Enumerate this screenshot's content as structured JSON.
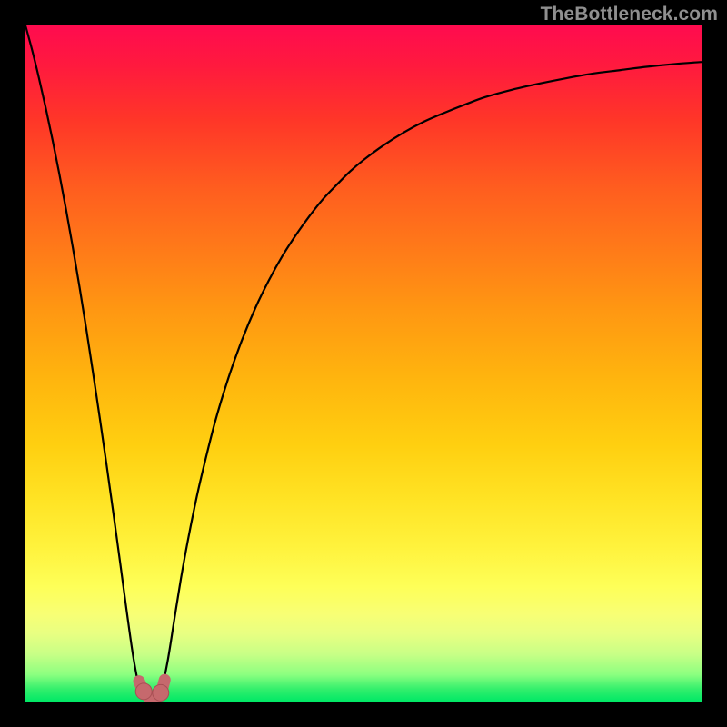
{
  "watermark": "TheBottleneck.com",
  "colors": {
    "frame": "#000000",
    "curve": "#000000",
    "marker_fill": "#c6696d",
    "marker_stroke": "#a84f54",
    "gradient_top": "#ff0b4f",
    "gradient_bottom": "#00e866"
  },
  "chart_data": {
    "type": "line",
    "title": "",
    "xlabel": "",
    "ylabel": "",
    "xlim": [
      0,
      100
    ],
    "ylim": [
      0,
      100
    ],
    "x": [
      0,
      1,
      2,
      3,
      4,
      5,
      6,
      7,
      8,
      9,
      10,
      11,
      12,
      13,
      14,
      15,
      16,
      17,
      18,
      19,
      20,
      21,
      22,
      23,
      24,
      25,
      26,
      28,
      30,
      32,
      34,
      36,
      38,
      40,
      42,
      44,
      46,
      48,
      50,
      53,
      56,
      59,
      62,
      65,
      68,
      72,
      76,
      80,
      84,
      88,
      92,
      96,
      100
    ],
    "y": [
      100,
      96.3,
      92.2,
      87.8,
      83.1,
      78.1,
      72.8,
      67.2,
      61.3,
      55.1,
      48.6,
      41.9,
      35.0,
      27.9,
      20.6,
      13.2,
      6.3,
      1.5,
      0.3,
      0.2,
      1.3,
      5.8,
      12.0,
      18.2,
      23.7,
      28.7,
      33.2,
      41.2,
      47.8,
      53.4,
      58.2,
      62.3,
      65.9,
      69.0,
      71.8,
      74.3,
      76.4,
      78.4,
      80.1,
      82.3,
      84.2,
      85.8,
      87.1,
      88.3,
      89.4,
      90.5,
      91.4,
      92.2,
      92.9,
      93.4,
      93.9,
      94.3,
      94.6
    ],
    "markers": [
      {
        "x": 17.5,
        "y": 1.5
      },
      {
        "x": 20.0,
        "y": 1.3
      }
    ],
    "band": {
      "x": [
        16.8,
        17.5,
        18.3,
        19.1,
        20.0,
        20.6
      ],
      "y": [
        3.0,
        1.5,
        0.6,
        0.4,
        1.3,
        3.2
      ]
    }
  }
}
